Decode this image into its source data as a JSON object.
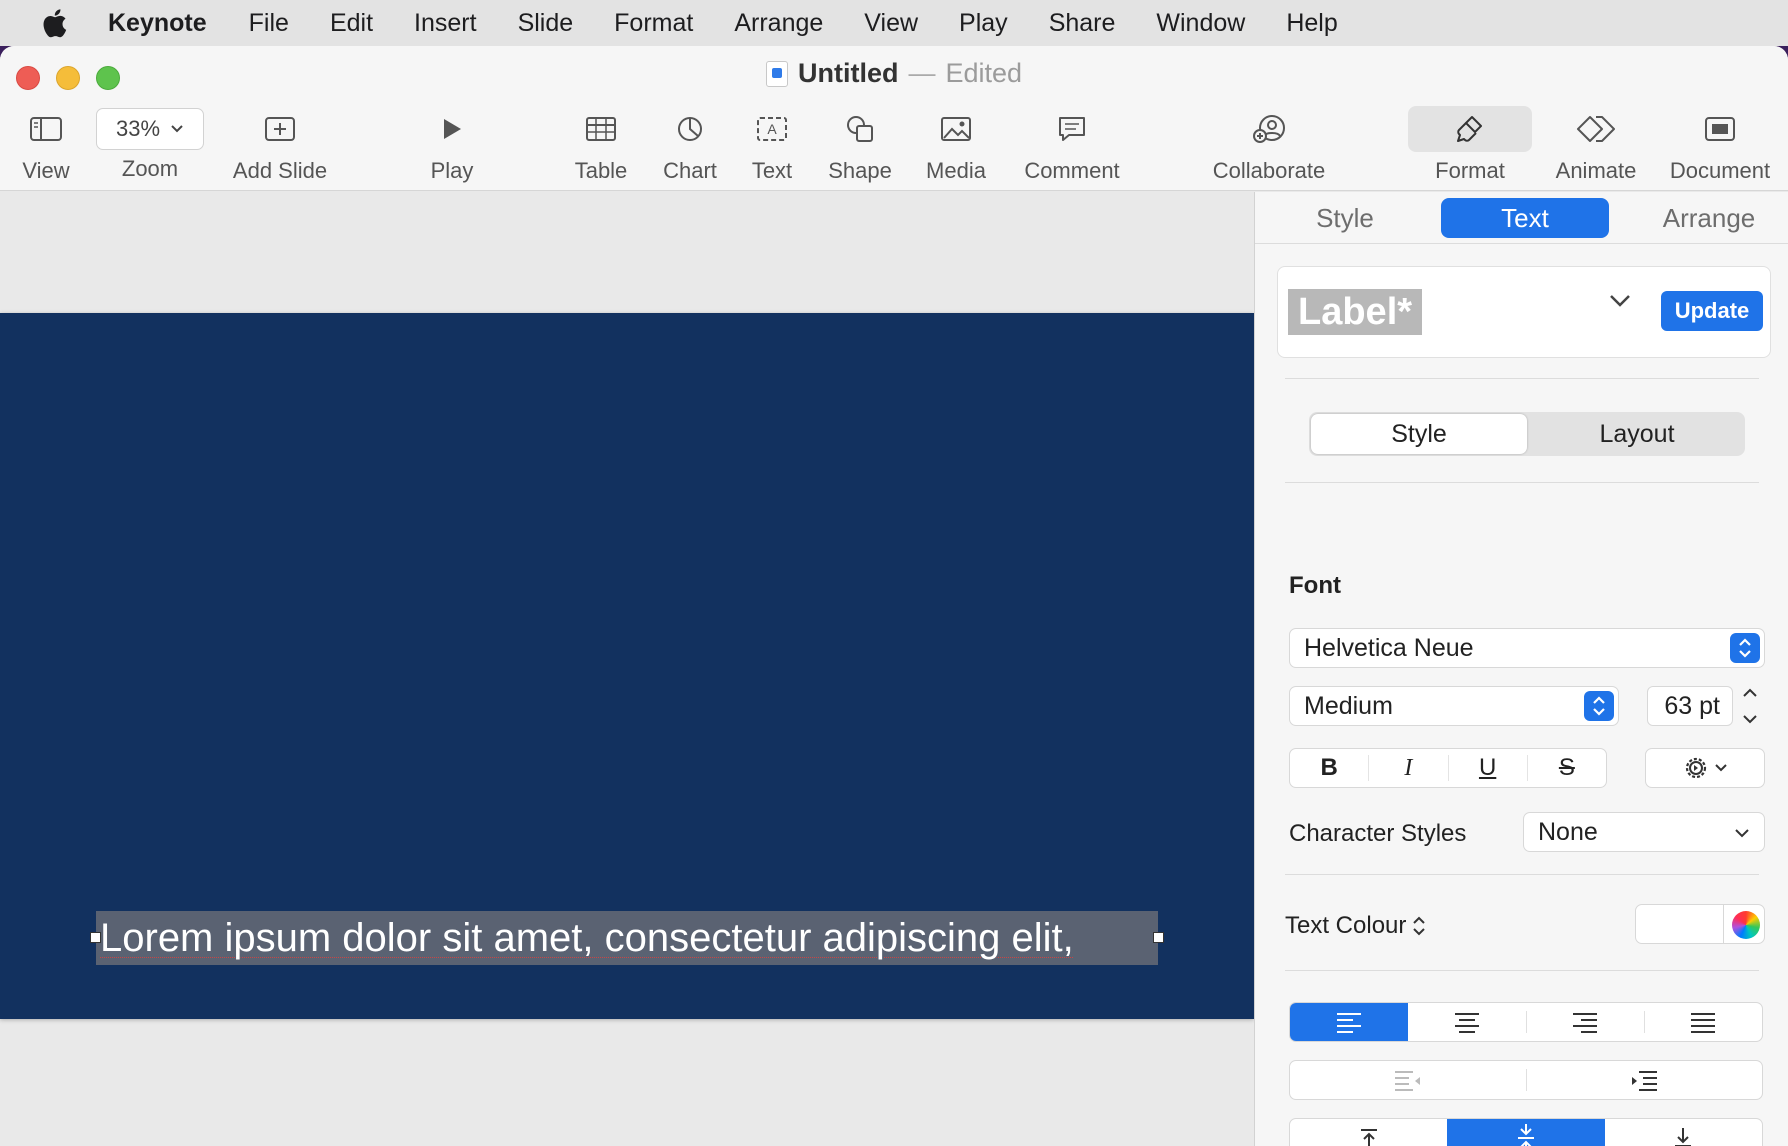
{
  "menubar": {
    "app_name": "Keynote",
    "items": [
      "File",
      "Edit",
      "Insert",
      "Slide",
      "Format",
      "Arrange",
      "View",
      "Play",
      "Share",
      "Window",
      "Help"
    ]
  },
  "window": {
    "title": "Untitled",
    "separator": "—",
    "status": "Edited"
  },
  "toolbar": {
    "view": "View",
    "zoom_value": "33%",
    "zoom": "Zoom",
    "add_slide": "Add Slide",
    "play": "Play",
    "table": "Table",
    "chart": "Chart",
    "text": "Text",
    "shape": "Shape",
    "media": "Media",
    "comment": "Comment",
    "collaborate": "Collaborate",
    "format": "Format",
    "animate": "Animate",
    "document": "Document"
  },
  "slide": {
    "background_color": "#12315f",
    "text": "Lorem ipsum dolor sit amet, consectetur adipiscing elit,"
  },
  "inspector": {
    "tabs": [
      "Style",
      "Text",
      "Arrange"
    ],
    "active_tab": "Text",
    "paragraph_style": "Label*",
    "update_button": "Update",
    "subtabs": [
      "Style",
      "Layout"
    ],
    "active_subtab": "Style",
    "font_heading": "Font",
    "font_family": "Helvetica Neue",
    "font_weight": "Medium",
    "font_size": "63 pt",
    "bold": "B",
    "italic": "I",
    "underline": "U",
    "strikethrough": "S",
    "character_styles_label": "Character Styles",
    "character_styles_value": "None",
    "text_colour_label": "Text Colour",
    "text_colour": "#ffffff",
    "accent_color": "#1f73e8",
    "alignment_selected": "left",
    "vertical_alignment_selected": "middle"
  }
}
